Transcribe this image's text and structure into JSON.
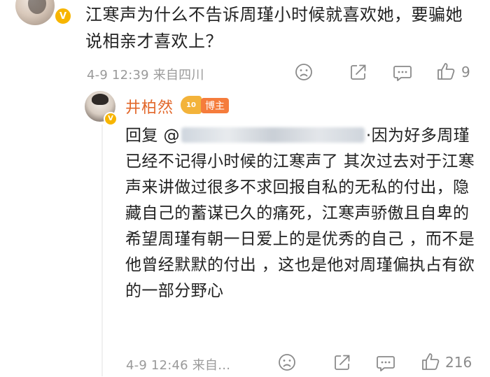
{
  "top_comment": {
    "text": "江寒声为什么不告诉周瑾小时候就喜欢她，要骗她说相亲才喜欢上？",
    "meta": "4-9 12:39  来自四川",
    "like_count": "9",
    "icons": [
      "sad-face-icon",
      "share-icon",
      "comment-icon",
      "thumbs-up-icon"
    ]
  },
  "reply": {
    "author": "井柏然",
    "level": "10",
    "badge": "博主",
    "prefix": "回复 @",
    "text": "·因为好多周瑾已经不记得小时候的江寒声了 其次过去对于江寒声来讲做过很多不求回报自私的无私的付出，隐藏自己的蓄谋已久的痛死，江寒声骄傲且自卑的希望周瑾有朝一日爱上的是优秀的自己 ，而不是他曾经默默的付出 ，这也是他对周瑾偏执占有欲的一部分野心",
    "meta": "4-9 12:46  来自…",
    "like_count": "216"
  },
  "colors": {
    "author_name": "#e2672a",
    "verified_badge": "#f7b500",
    "blogger_badge": "#f57c3c",
    "meta_text": "#9a9a9a"
  }
}
